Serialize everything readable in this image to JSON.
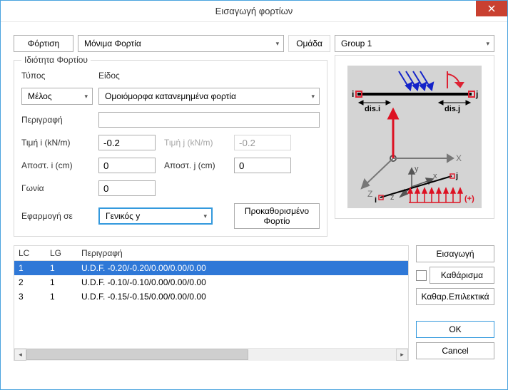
{
  "window": {
    "title": "Εισαγωγή φορτίων"
  },
  "top": {
    "fortisi_label": "Φόρτιση",
    "monima": "Μόνιμα Φορτία",
    "omada_label": "Ομάδα",
    "group": "Group 1"
  },
  "props": {
    "legend": "Ιδιότητα Φορτίου",
    "typos_label": "Τύπος",
    "eidos_label": "Είδος",
    "typos_value": "Μέλος",
    "eidos_value": "Ομοιόμορφα κατανεμημένα φορτία",
    "perigrafi_label": "Περιγραφή",
    "perigrafi_value": "",
    "timii_label": "Τιμή i (kN/m)",
    "timii_value": "-0.2",
    "timij_label": "Τιμή j (kN/m)",
    "timij_value": "-0.2",
    "aposti_label": "Αποστ. i (cm)",
    "aposti_value": "0",
    "apostj_label": "Αποστ. j (cm)",
    "apostj_value": "0",
    "gonia_label": "Γωνία",
    "gonia_value": "0",
    "efarm_label": "Εφαρμογή σε",
    "efarm_value": "Γενικός y",
    "predef_label": "Προκαθορισμένο Φορτίο"
  },
  "preview": {
    "i": "i",
    "j": "j",
    "disi": "dis.i",
    "disj": "dis.j",
    "X": "X",
    "Y": "y",
    "x_s": "x",
    "Z": "Z",
    "z_s": "z",
    "plus": "(+)"
  },
  "grid": {
    "headers": {
      "lc": "LC",
      "lg": "LG",
      "desc": "Περιγραφή"
    },
    "rows": [
      {
        "lc": "1",
        "lg": "1",
        "desc": "U.D.F. -0.20/-0.20/0.00/0.00/0.00",
        "selected": true
      },
      {
        "lc": "2",
        "lg": "1",
        "desc": "U.D.F. -0.10/-0.10/0.00/0.00/0.00",
        "selected": false
      },
      {
        "lc": "3",
        "lg": "1",
        "desc": "U.D.F. -0.15/-0.15/0.00/0.00/0.00",
        "selected": false
      }
    ]
  },
  "side": {
    "eisagogi": "Εισαγωγή",
    "katharisma": "Καθάρισμα",
    "kathar_epil": "Καθαρ.Επιλεκτικά",
    "ok": "OK",
    "cancel": "Cancel"
  }
}
